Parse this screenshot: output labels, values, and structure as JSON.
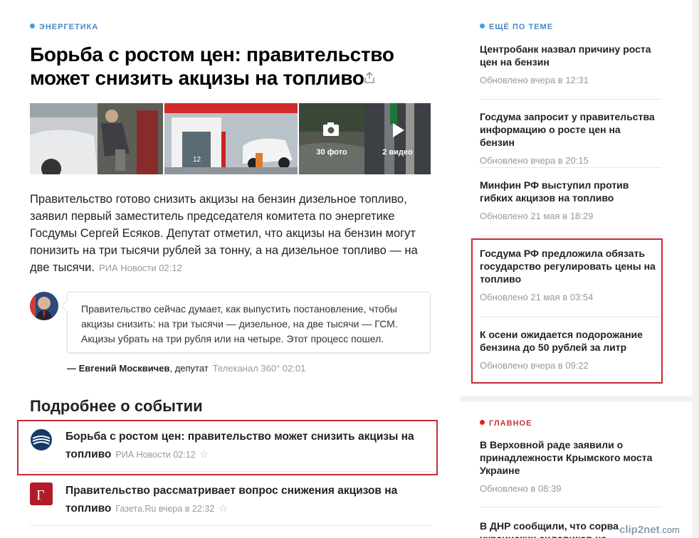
{
  "article": {
    "rubric": "ЭНЕРГЕТИКА",
    "title": "Борьба с ростом цен: правительство может снизить акцизы на топливо",
    "gallery": {
      "photos_count": "30 фото",
      "videos_count": "2 видео"
    },
    "lead_text": "Правительство готово снизить акцизы на бензин дизельное топливо, заявил первый заместитель председателя комитета по энергетике Госдумы Сергей Есяков. Депутат отметил, что акцизы на бензин могут понизить на три тысячи рублей за тонну, а на дизельное топливо — на две тысячи.",
    "lead_source": "РИА Новости 02:12",
    "quote": {
      "text": "Правительство сейчас думает, как выпустить постановление, чтобы акцизы снизить: на три тысячи — дизельное, на две тысячи — ГСМ. Акцизы убрать на три рубля или на четыре. Этот процесс пошел.",
      "author_name": "— Евгений Москвичев",
      "author_role": ", депутат",
      "source": "Телеканал 360° 02:01"
    },
    "details_heading": "Подробнее о событии",
    "details": [
      {
        "title": "Борьба с ростом цен: правительство может снизить акцизы на топливо",
        "source": "РИА Новости 02:12",
        "star": "☆"
      },
      {
        "title": "Правительство рассматривает вопрос снижения акцизов на топливо",
        "source": "Газета.Ru вчера в 22:32",
        "star": "☆"
      }
    ]
  },
  "sidebar": {
    "more_rubric": "ЕЩЁ ПО ТЕМЕ",
    "more": [
      {
        "title": "Центробанк назвал причину роста цен на бензин",
        "date": "Обновлено вчера в 12:31"
      },
      {
        "title": "Госдума запросит у правительства информацию о росте цен на бензин",
        "date": "Обновлено вчера в 20:15"
      },
      {
        "title": "Минфин РФ выступил против гибких акцизов на топливо",
        "date": "Обновлено 21 мая в 18:29"
      },
      {
        "title": "Госдума РФ предложила обязать государство регулировать цены на топливо",
        "date": "Обновлено 21 мая в 03:54"
      },
      {
        "title": "К осени ожидается подорожание бензина до 50 рублей за литр",
        "date": "Обновлено вчера в 09:22"
      }
    ],
    "main_rubric": "ГЛАВНОЕ",
    "main": [
      {
        "title": "В Верховной раде заявили о принадлежности Крымского моста Украине",
        "date": "Обновлено в 08:39"
      },
      {
        "title": "В ДНР сообщили, что сорва украинских силовиков на",
        "date": ""
      }
    ]
  },
  "watermark": {
    "brand": "clip2net",
    "suffix": ".com"
  },
  "colors": {
    "rubric_blue": "#3a9fe8",
    "rubric_red": "#e02020",
    "highlight": "#c62b33"
  }
}
